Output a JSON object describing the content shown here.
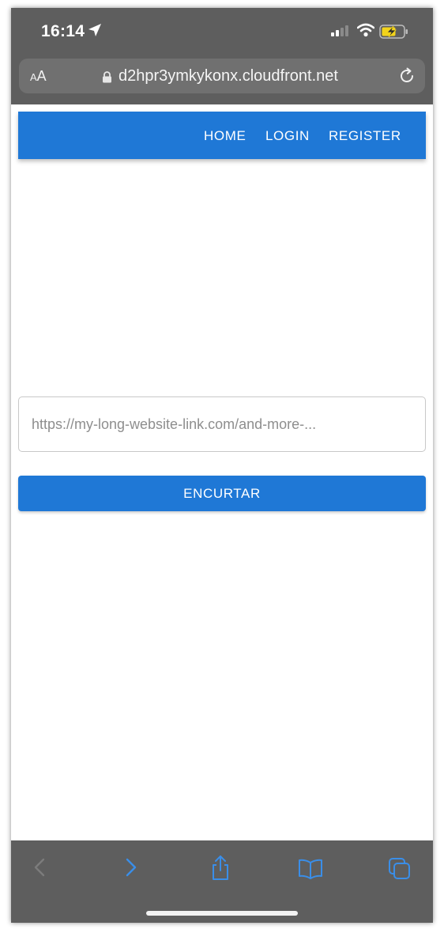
{
  "status_bar": {
    "time": "16:14"
  },
  "browser": {
    "text_size_label_small": "A",
    "text_size_label_large": "A",
    "url": "d2hpr3ymkykonx.cloudfront.net"
  },
  "navbar": {
    "links": [
      "HOME",
      "LOGIN",
      "REGISTER"
    ],
    "color": "#1f78d6"
  },
  "main": {
    "url_input": {
      "value": "",
      "placeholder": "https://my-long-website-link.com/and-more-..."
    },
    "shorten_button_label": "ENCURTAR"
  },
  "toolbar": {
    "icons": [
      "back-icon",
      "forward-icon",
      "share-icon",
      "bookmarks-icon",
      "tabs-icon"
    ],
    "active_color": "#3a8ee8",
    "disabled_color": "#7c7c7c"
  }
}
